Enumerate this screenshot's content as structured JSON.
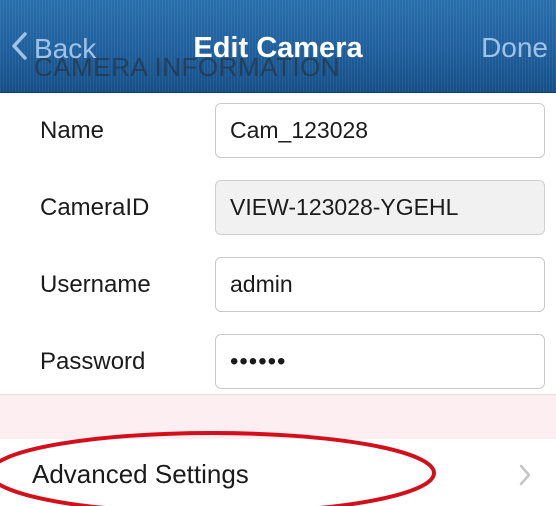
{
  "navbar": {
    "back_label": "Back",
    "title": "Edit Camera",
    "done_label": "Done"
  },
  "section_header": "CAMERA INFORMATION",
  "form": {
    "rows": [
      {
        "label": "Name",
        "value": "Cam_123028",
        "editable": true
      },
      {
        "label": "CameraID",
        "value": "VIEW-123028-YGEHL",
        "editable": false
      },
      {
        "label": "Username",
        "value": "admin",
        "editable": true
      },
      {
        "label": "Password",
        "value": "••••••",
        "editable": true
      }
    ]
  },
  "advanced": {
    "label": "Advanced Settings"
  },
  "colors": {
    "navbar": "#1f5f9c",
    "nav_button": "#9fc3e6",
    "annotation": "#d40f1c",
    "alert_band": "#fdeff1"
  },
  "icons": {
    "back": "chevron-left-icon",
    "advanced": "chevron-right-icon"
  }
}
